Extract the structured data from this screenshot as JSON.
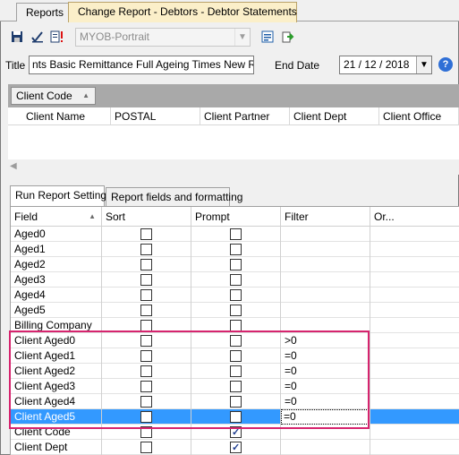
{
  "tabs": {
    "reports": "Reports",
    "active": "Change Report - Debtors - Debtor Statements"
  },
  "toolbar": {
    "save_icon": "floppy-disk-icon",
    "edit_icon": "edit-check-icon",
    "alert_icon": "report-alert-icon",
    "layout_value": "MYOB-Portrait",
    "properties_icon": "properties-icon",
    "export_icon": "export-arrow-icon"
  },
  "title": {
    "label": "Title",
    "value": "nts Basic Remittance Full Ageing Times New Roman"
  },
  "end_date": {
    "label": "End Date",
    "value": "21 / 12 / 2018"
  },
  "grouping": {
    "chip": "Client Code"
  },
  "client_columns": [
    "Client Name",
    "POSTAL",
    "Client Partner",
    "Client Dept",
    "Client Office"
  ],
  "lower_tabs": {
    "active": "Run Report Settings",
    "other": "Report fields and formatting"
  },
  "grid": {
    "headers": {
      "field": "Field",
      "sort": "Sort",
      "prompt": "Prompt",
      "filter": "Filter",
      "order": "Or..."
    },
    "rows": [
      {
        "field": "Aged0",
        "sort": false,
        "prompt": false,
        "filter": ""
      },
      {
        "field": "Aged1",
        "sort": false,
        "prompt": false,
        "filter": ""
      },
      {
        "field": "Aged2",
        "sort": false,
        "prompt": false,
        "filter": ""
      },
      {
        "field": "Aged3",
        "sort": false,
        "prompt": false,
        "filter": ""
      },
      {
        "field": "Aged4",
        "sort": false,
        "prompt": false,
        "filter": ""
      },
      {
        "field": "Aged5",
        "sort": false,
        "prompt": false,
        "filter": ""
      },
      {
        "field": "Billing Company",
        "sort": false,
        "prompt": false,
        "filter": ""
      },
      {
        "field": "Client Aged0",
        "sort": false,
        "prompt": false,
        "filter": ">0"
      },
      {
        "field": "Client Aged1",
        "sort": false,
        "prompt": false,
        "filter": "=0"
      },
      {
        "field": "Client Aged2",
        "sort": false,
        "prompt": false,
        "filter": "=0"
      },
      {
        "field": "Client Aged3",
        "sort": false,
        "prompt": false,
        "filter": "=0"
      },
      {
        "field": "Client Aged4",
        "sort": false,
        "prompt": false,
        "filter": "=0"
      },
      {
        "field": "Client Aged5",
        "sort": false,
        "prompt": false,
        "filter": "=0",
        "selected": true
      },
      {
        "field": "Client Code",
        "sort": false,
        "prompt": true,
        "filter": ""
      },
      {
        "field": "Client Dept",
        "sort": false,
        "prompt": true,
        "filter": ""
      }
    ]
  },
  "colors": {
    "selection": "#3399ff",
    "highlight": "#d6246e",
    "active_tab": "#fbefc9",
    "group_area": "#a9a9a9"
  }
}
